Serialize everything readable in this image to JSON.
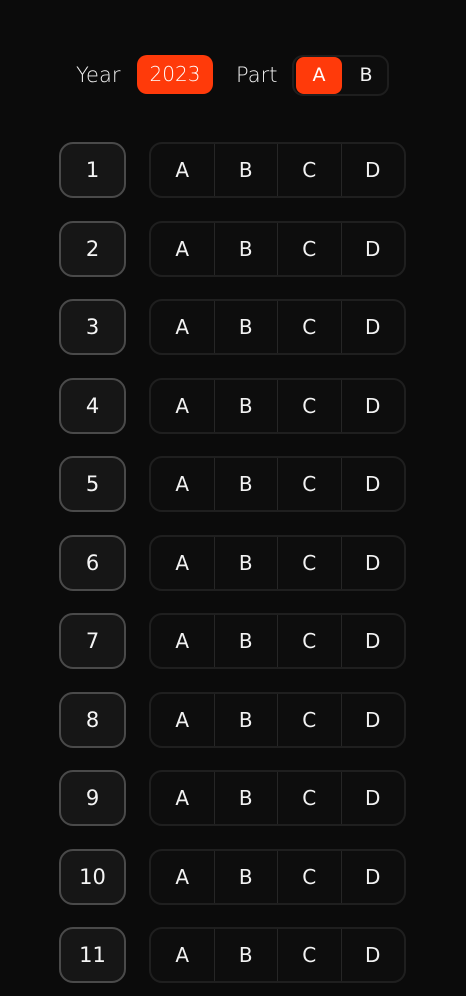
{
  "header": {
    "year_label": "Year",
    "year_value": "2023",
    "part_label": "Part",
    "part_options": [
      "A",
      "B"
    ],
    "part_selected": "A"
  },
  "colors": {
    "accent": "#ff3a0a",
    "background": "#0b0b0b"
  },
  "questions": [
    {
      "number": "1",
      "options": [
        "A",
        "B",
        "C",
        "D"
      ]
    },
    {
      "number": "2",
      "options": [
        "A",
        "B",
        "C",
        "D"
      ]
    },
    {
      "number": "3",
      "options": [
        "A",
        "B",
        "C",
        "D"
      ]
    },
    {
      "number": "4",
      "options": [
        "A",
        "B",
        "C",
        "D"
      ]
    },
    {
      "number": "5",
      "options": [
        "A",
        "B",
        "C",
        "D"
      ]
    },
    {
      "number": "6",
      "options": [
        "A",
        "B",
        "C",
        "D"
      ]
    },
    {
      "number": "7",
      "options": [
        "A",
        "B",
        "C",
        "D"
      ]
    },
    {
      "number": "8",
      "options": [
        "A",
        "B",
        "C",
        "D"
      ]
    },
    {
      "number": "9",
      "options": [
        "A",
        "B",
        "C",
        "D"
      ]
    },
    {
      "number": "10",
      "options": [
        "A",
        "B",
        "C",
        "D"
      ]
    },
    {
      "number": "11",
      "options": [
        "A",
        "B",
        "C",
        "D"
      ]
    }
  ]
}
